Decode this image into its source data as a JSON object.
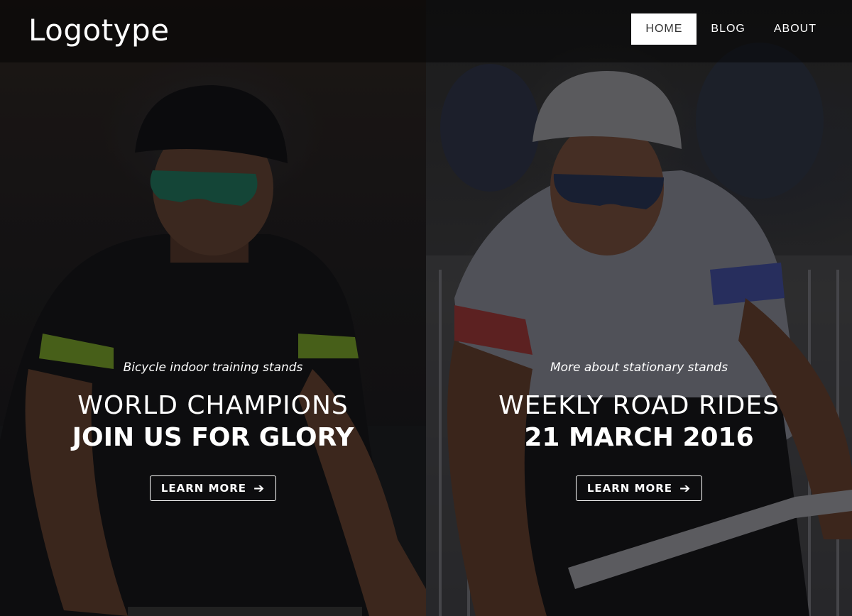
{
  "header": {
    "logo": "Logotype",
    "nav": [
      {
        "label": "HOME",
        "active": true
      },
      {
        "label": "BLOG",
        "active": false
      },
      {
        "label": "ABOUT",
        "active": false
      }
    ]
  },
  "slides": [
    {
      "kicker": "Bicycle indoor training stands",
      "title_light": "WORLD CHAMPIONS",
      "title_bold": "JOIN US FOR GLORY",
      "button": "LEARN MORE",
      "button_icon": "arrow-right-icon",
      "image": "cyclist-black-green-jersey-photo"
    },
    {
      "kicker": "More about stationary stands",
      "title_light": "WEEKLY ROAD RIDES",
      "title_bold": "21 MARCH 2016",
      "button": "LEARN MORE",
      "button_icon": "arrow-right-icon",
      "image": "cyclist-white-red-jersey-photo"
    }
  ],
  "colors": {
    "nav_active_bg": "#ffffff",
    "nav_active_text": "#333333",
    "text": "#ffffff"
  }
}
